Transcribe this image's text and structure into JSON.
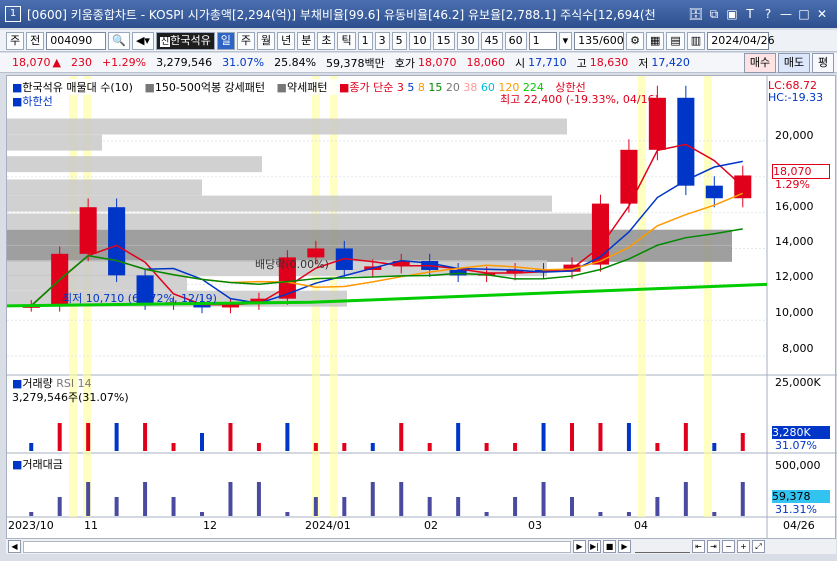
{
  "window": {
    "num": "1",
    "title": "[0600] 키움종합차트 - KOSPI 시가총액[2,294(억)] 부채비율[99.6] 유동비율[46.2] 유보율[2,788.1] 주식수[12,694(천"
  },
  "toolbar": {
    "type": "주",
    "prev": "전",
    "code": "004090",
    "name": "한국석유",
    "periods": [
      "일",
      "주",
      "월",
      "년",
      "분",
      "초",
      "틱"
    ],
    "nums": [
      "1",
      "3",
      "5",
      "10",
      "15",
      "30",
      "45",
      "60"
    ],
    "unit": "1",
    "count": "135/600",
    "date": "2024/04/26"
  },
  "info": {
    "price": "18,070",
    "arrow": "▲",
    "change": "230",
    "pct": "+1.29%",
    "volume": "3,279,546",
    "turnover": "31.07%",
    "rate": "25.84%",
    "amount": "59,378백만",
    "ask_label": "호가",
    "ask": "18,070",
    "bid": "18,060",
    "open_label": "시",
    "open": "17,710",
    "high_label": "고",
    "high": "18,630",
    "low_label": "저",
    "low": "17,420",
    "buy": "매수",
    "sell": "매도",
    "more": "평"
  },
  "legend": {
    "main": "한국석유 매물대 수(10)",
    "line2": "150-500억봉 강세패턴",
    "line3": "약세패턴",
    "ma_label": "종가 단순",
    "ma": [
      "3",
      "5",
      "8",
      "15",
      "20",
      "38",
      "60",
      "120",
      "224"
    ],
    "upper": "상한선",
    "lower": "하한선",
    "lc": "LC:68.72",
    "hc": "HC:-19.33"
  },
  "annotations": {
    "max": "최고 22,400 (-19.33%, 04/16)",
    "min": "최저 10,710 (68.72%, 12/19)",
    "div": "배당락(0.00%)"
  },
  "price_axis": {
    "ticks": [
      "20,000",
      "18,000",
      "16,000",
      "14,000",
      "12,000",
      "10,000",
      "8,000"
    ],
    "cur": "18,070",
    "curpct": "1.29%"
  },
  "volume": {
    "title": "거래량",
    "rsi": "RSI 14",
    "value": "3,279,546주(31.07%)",
    "axis_top": "25,000K",
    "cur": "3,280K",
    "curpct": "31.07%"
  },
  "amount": {
    "title": "거래대금",
    "axis_top": "500,000",
    "cur": "59,378",
    "curpct": "31.31%"
  },
  "dates": [
    "2023/10",
    "11",
    "12",
    "2024/01",
    "02",
    "03",
    "04",
    "04/26"
  ],
  "colors": {
    "up": "#e0001b",
    "down": "#0036c8",
    "ma120": "#ff9900",
    "ma224": "#00cc00"
  },
  "chart_data": {
    "type": "candlestick",
    "title": "",
    "xlabel": "",
    "ylabel": "",
    "ylim": [
      7000,
      22500
    ],
    "x": [
      "2023/10",
      "11",
      "12",
      "2024/01",
      "02",
      "03",
      "04",
      "04/26"
    ],
    "series": [
      {
        "name": "한국석유",
        "values": [
          10800,
          13700,
          16300,
          12500,
          10900,
          11000,
          10710,
          10900,
          11200,
          13500,
          14000,
          12800,
          13000,
          13300,
          12800,
          12500,
          12600,
          12800,
          12700,
          13100,
          16500,
          19500,
          22400,
          17500,
          16800,
          18070
        ]
      }
    ],
    "annotations": {
      "max": {
        "value": 22400,
        "date": "04/16"
      },
      "min": {
        "value": 10710,
        "date": "12/19"
      }
    }
  }
}
